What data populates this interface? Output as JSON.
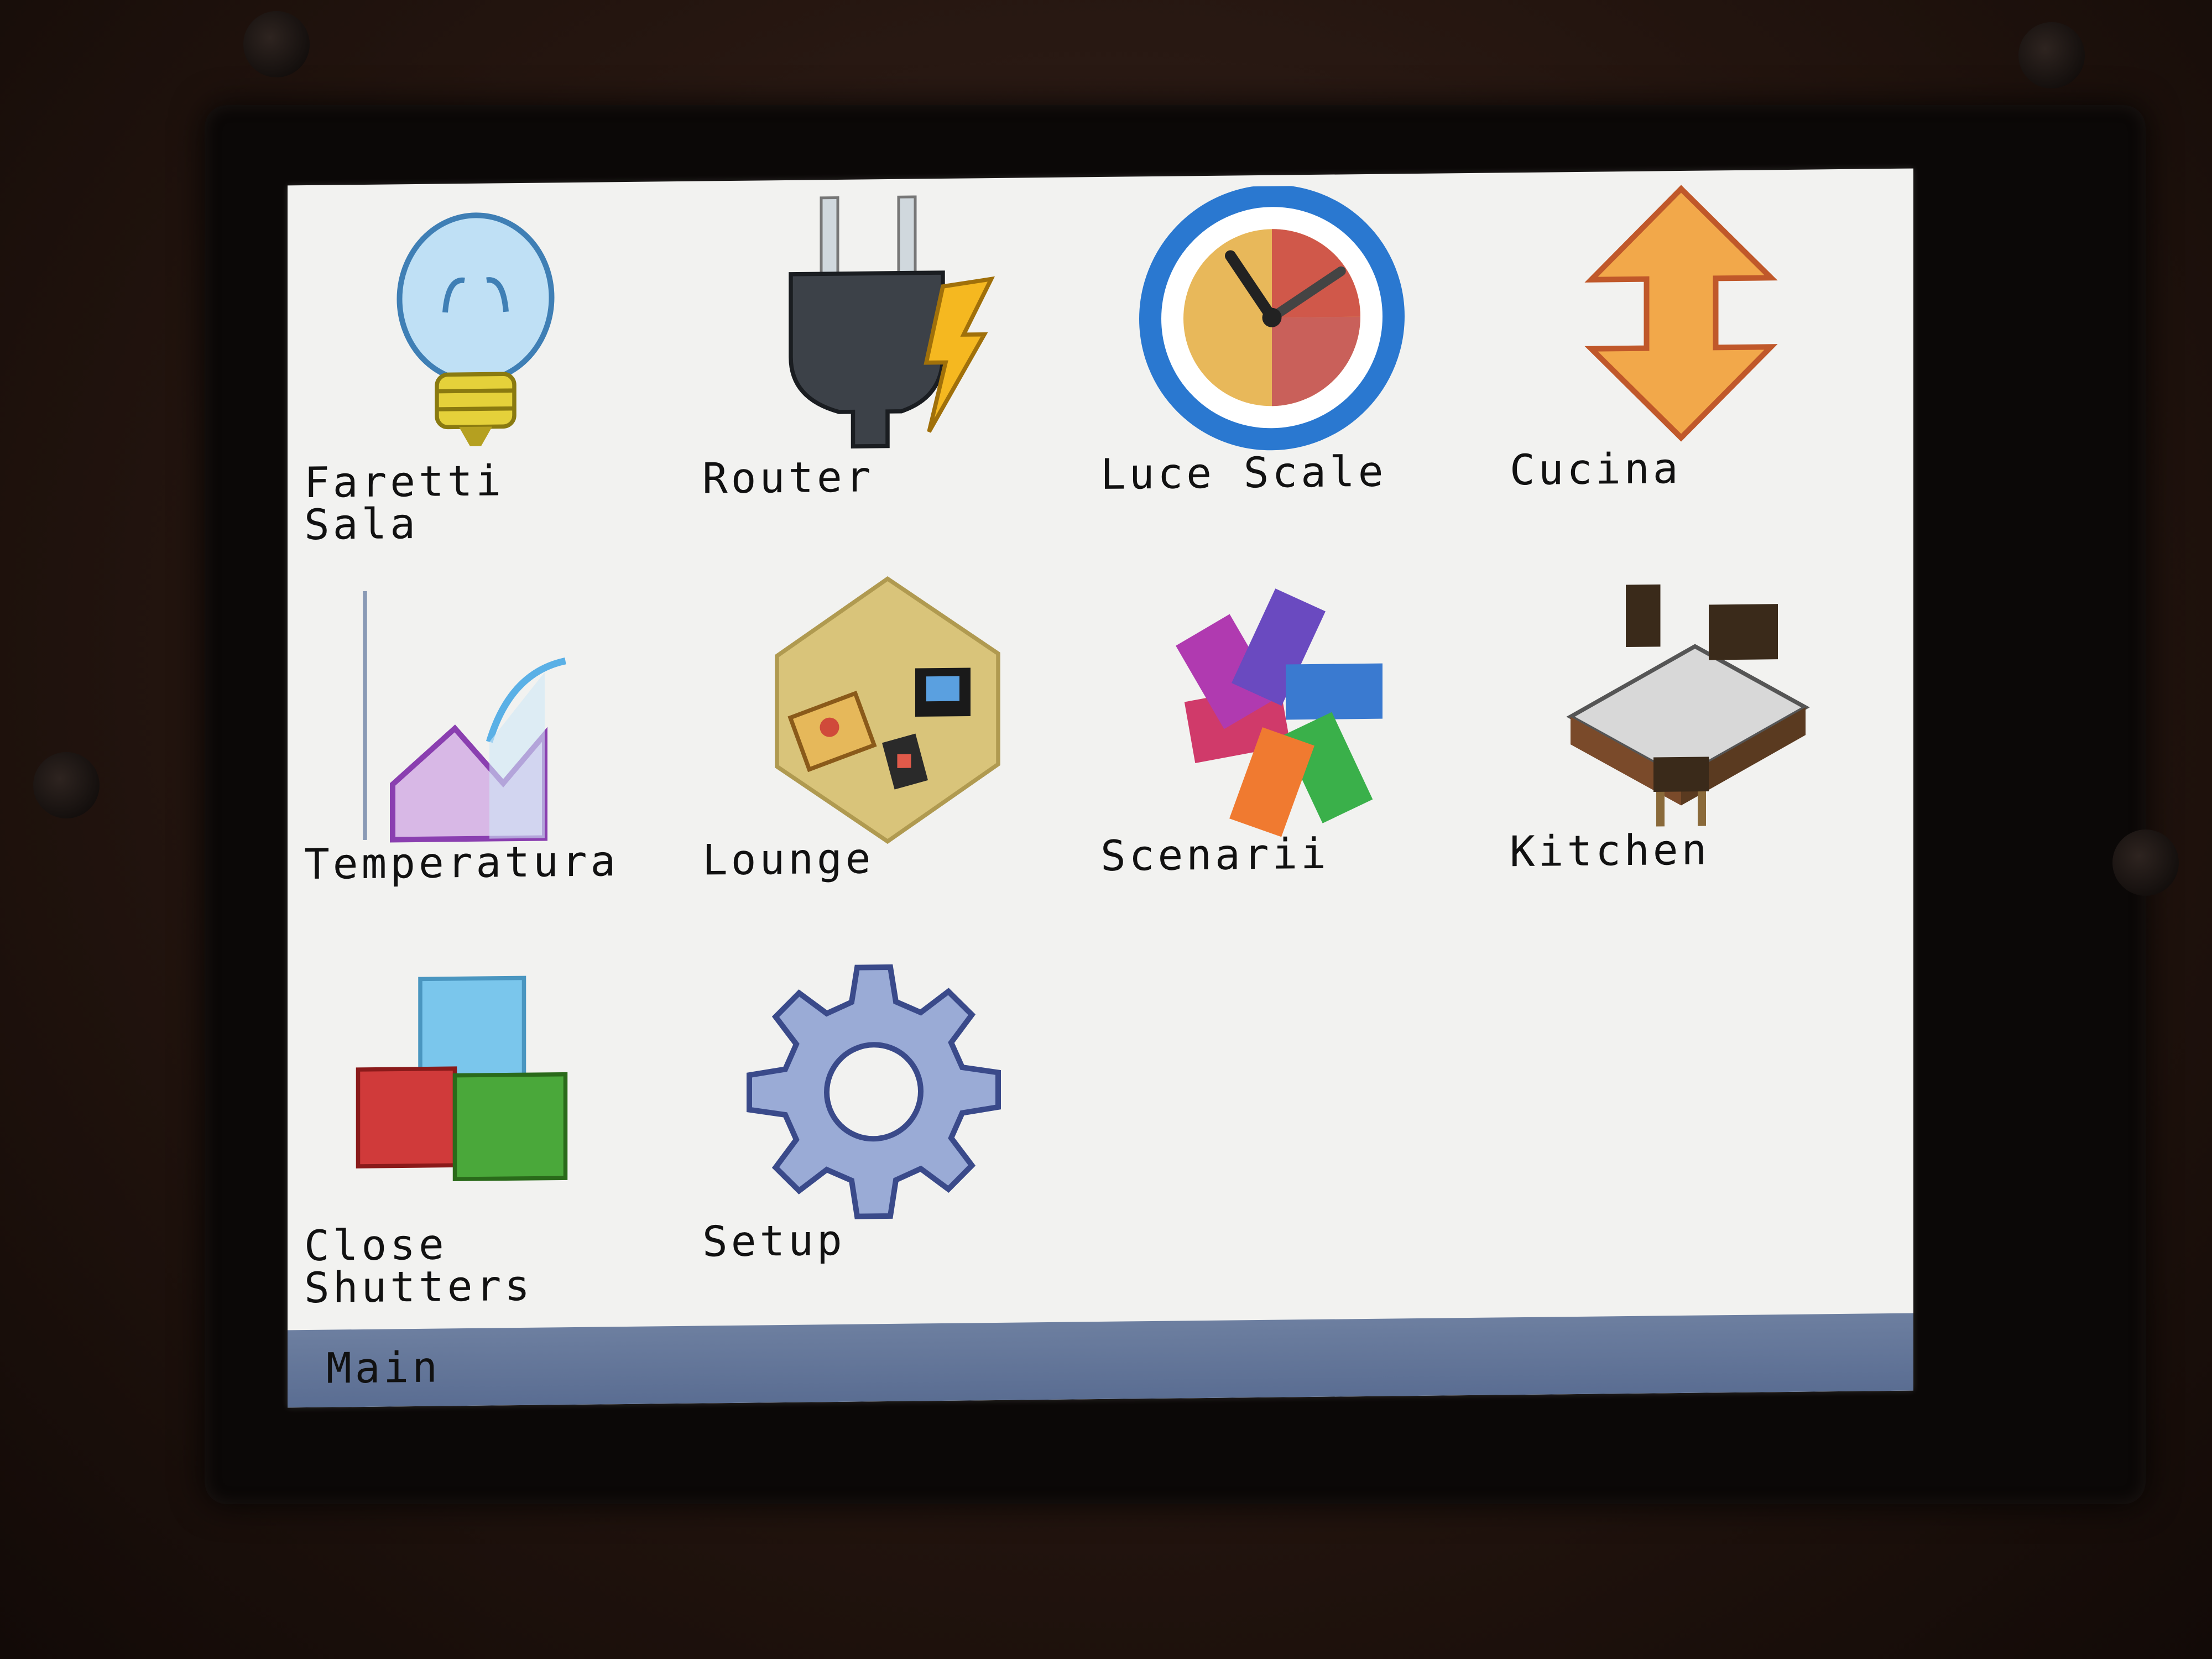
{
  "menu": {
    "items": [
      {
        "label": "Faretti\nSala",
        "icon": "light-bulb-icon"
      },
      {
        "label": "Router",
        "icon": "power-plug-icon"
      },
      {
        "label": "Luce Scale",
        "icon": "clock-icon"
      },
      {
        "label": "Cucina",
        "icon": "up-down-arrow-icon"
      },
      {
        "label": "Temperatura",
        "icon": "line-graph-icon"
      },
      {
        "label": "Lounge",
        "icon": "lounge-room-icon"
      },
      {
        "label": "Scenarii",
        "icon": "color-swatches-icon"
      },
      {
        "label": "Kitchen",
        "icon": "kitchen-layout-icon"
      },
      {
        "label": "Close\nShutters",
        "icon": "cubes-icon"
      },
      {
        "label": "Setup",
        "icon": "gear-icon"
      }
    ]
  },
  "status_bar": {
    "title": "Main"
  },
  "colors": {
    "screen_background": "#f2f2f0",
    "status_bar": "#5a6d92",
    "text": "#111111"
  }
}
